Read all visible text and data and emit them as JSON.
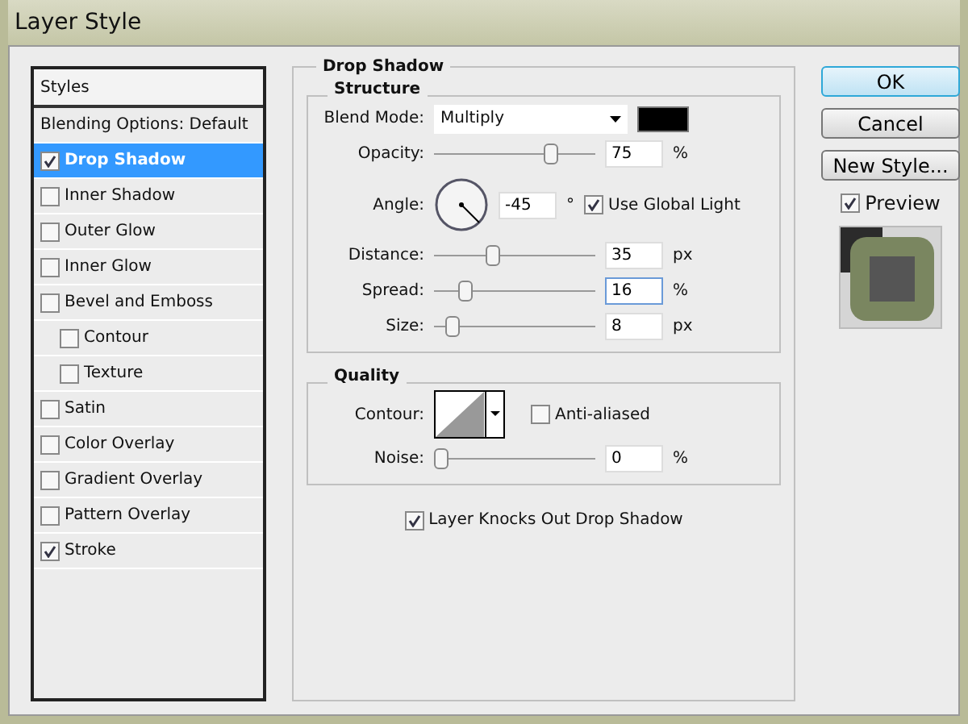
{
  "window": {
    "title": "Layer Style"
  },
  "styles": {
    "header": "Styles",
    "items": [
      {
        "label": "Blending Options: Default",
        "kind": "plain",
        "selected": false
      },
      {
        "label": "Drop Shadow",
        "kind": "check",
        "checked": true,
        "selected": true
      },
      {
        "label": "Inner Shadow",
        "kind": "check",
        "checked": false,
        "selected": false
      },
      {
        "label": "Outer Glow",
        "kind": "check",
        "checked": false,
        "selected": false
      },
      {
        "label": "Inner Glow",
        "kind": "check",
        "checked": false,
        "selected": false
      },
      {
        "label": "Bevel and Emboss",
        "kind": "check",
        "checked": false,
        "selected": false,
        "children": [
          {
            "label": "Contour",
            "kind": "check",
            "checked": false,
            "selected": false
          },
          {
            "label": "Texture",
            "kind": "check",
            "checked": false,
            "selected": false
          }
        ]
      },
      {
        "label": "Satin",
        "kind": "check",
        "checked": false,
        "selected": false
      },
      {
        "label": "Color Overlay",
        "kind": "check",
        "checked": false,
        "selected": false
      },
      {
        "label": "Gradient Overlay",
        "kind": "check",
        "checked": false,
        "selected": false
      },
      {
        "label": "Pattern Overlay",
        "kind": "check",
        "checked": false,
        "selected": false
      },
      {
        "label": "Stroke",
        "kind": "check",
        "checked": true,
        "selected": false
      }
    ]
  },
  "panel": {
    "title": "Drop Shadow",
    "structure": {
      "title": "Structure",
      "blend_mode": {
        "label": "Blend Mode:",
        "value": "Multiply"
      },
      "rows": [
        {
          "kind": "slider",
          "label": "Opacity:",
          "level": 0.75,
          "value": "75",
          "unit": "%"
        },
        {
          "kind": "angle",
          "label": "Angle:",
          "value": "-45",
          "unit": "°",
          "check": {
            "label": "Use Global Light",
            "checked": true
          }
        },
        {
          "kind": "slider",
          "label": "Distance:",
          "level": 0.35,
          "value": "35",
          "unit": "px"
        },
        {
          "kind": "slider",
          "label": "Spread:",
          "level": 0.16,
          "value": "16",
          "unit": "%",
          "highlighted": true
        },
        {
          "kind": "slider",
          "label": "Size:",
          "level": 0.08,
          "value": "8",
          "unit": "px"
        }
      ]
    },
    "quality": {
      "title": "Quality",
      "contour": {
        "label": "Contour:",
        "check": {
          "label": "Anti-aliased",
          "checked": false
        }
      },
      "noise": {
        "label": "Noise:",
        "level": 0,
        "value": "0",
        "unit": "%"
      }
    },
    "knockout": {
      "label": "Layer Knocks Out Drop Shadow",
      "checked": true
    }
  },
  "buttons": [
    {
      "label": "OK",
      "default": true
    },
    {
      "label": "Cancel",
      "default": false
    },
    {
      "label": "New Style...",
      "default": false
    }
  ],
  "preview": {
    "label": "Preview",
    "checked": true
  }
}
